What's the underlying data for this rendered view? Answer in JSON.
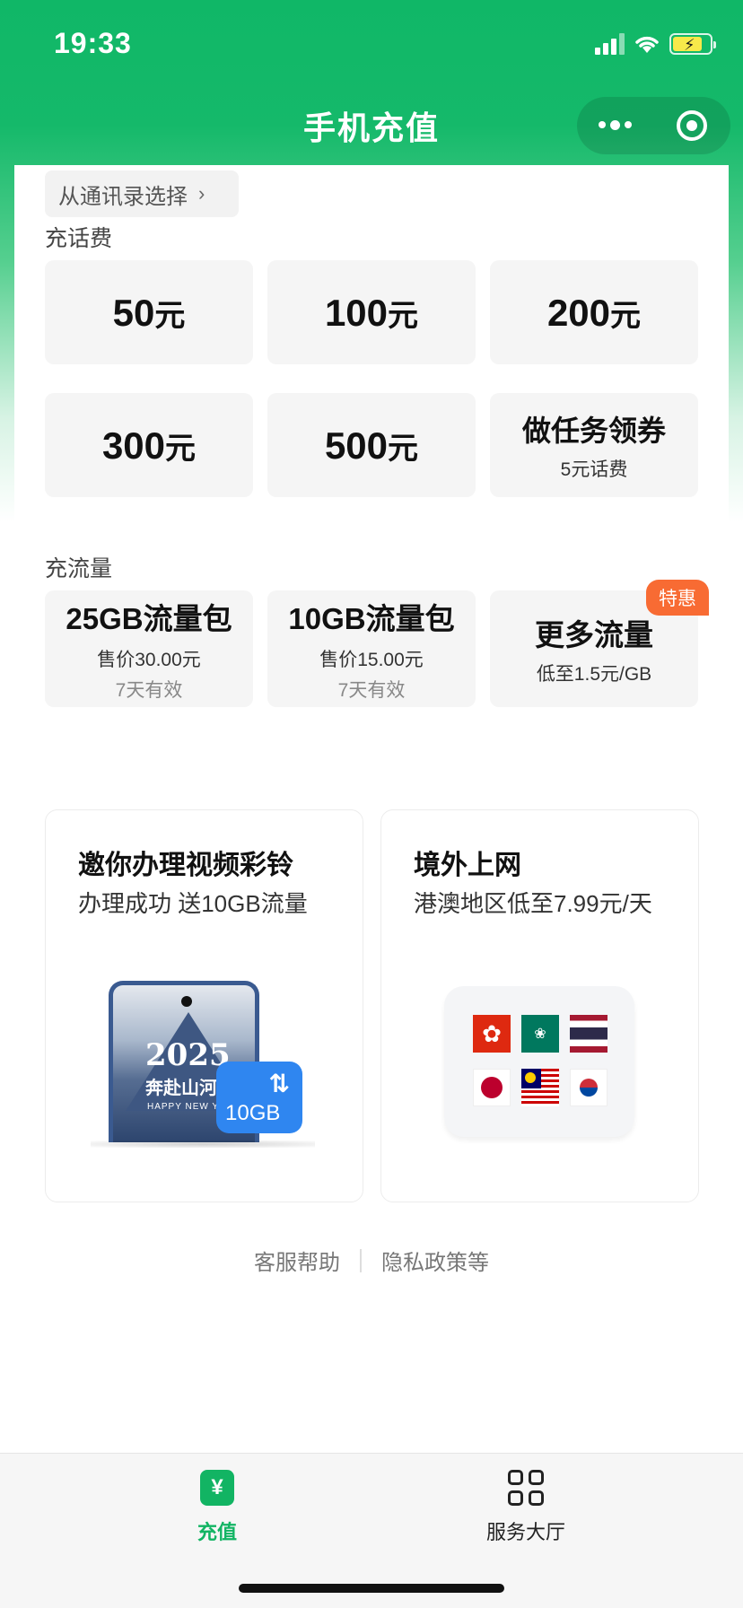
{
  "status_bar": {
    "time": "19:33"
  },
  "nav": {
    "title": "手机充值"
  },
  "contacts": {
    "label": "从通讯录选择",
    "chevron": "›"
  },
  "topup": {
    "section_title": "充话费",
    "unit": "元",
    "amounts": [
      "50",
      "100",
      "200",
      "300",
      "500"
    ],
    "task": {
      "title": "做任务领券",
      "subtitle": "5元话费"
    }
  },
  "data_plans": {
    "section_title": "充流量",
    "packages": [
      {
        "title": "25GB流量包",
        "price": "售价30.00元",
        "validity": "7天有效"
      },
      {
        "title": "10GB流量包",
        "price": "售价15.00元",
        "validity": "7天有效"
      }
    ],
    "more": {
      "badge": "特惠",
      "title": "更多流量",
      "subtitle": "低至1.5元/GB"
    }
  },
  "promos": [
    {
      "title": "邀你办理视频彩铃",
      "subtitle": "办理成功 送10GB流量",
      "illustration": {
        "year": "2025",
        "slogan": "奔赴山河",
        "caption": "HAPPY NEW YEAR",
        "chip": "10GB",
        "chip_arrows": "⇅"
      }
    },
    {
      "title": "境外上网",
      "subtitle": "港澳地区低至7.99元/天",
      "flags": [
        "hong-kong",
        "macau",
        "thailand",
        "japan",
        "malaysia",
        "south-korea"
      ]
    }
  ],
  "footer": {
    "help": "客服帮助",
    "privacy": "隐私政策等"
  },
  "tabbar": {
    "items": [
      {
        "label": "充值",
        "icon": "yuan-icon",
        "active": true
      },
      {
        "label": "服务大厅",
        "icon": "grid-icon",
        "active": false
      }
    ]
  },
  "colors": {
    "brand": "#12b463",
    "promo": "#f86b33",
    "tile_bg": "#f5f5f5"
  }
}
